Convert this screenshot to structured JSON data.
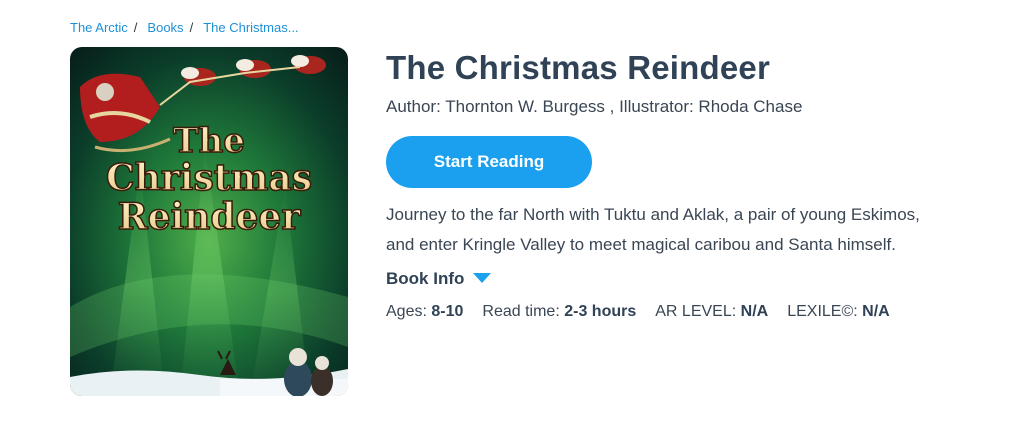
{
  "breadcrumb": {
    "items": [
      "The Arctic",
      "Books",
      "The Christmas..."
    ],
    "separator": "/"
  },
  "cover": {
    "title_lines": [
      "The",
      "Christmas",
      "Reindeer"
    ],
    "icon": "book-cover-image"
  },
  "book": {
    "title": "The Christmas Reindeer",
    "author_line": "Author: Thornton W. Burgess , Illustrator: Rhoda Chase",
    "start_label": "Start Reading",
    "description": "Journey to the far North with Tuktu and Aklak, a pair of young Eskimos, and enter Kringle Valley to meet magical caribou and Santa himself.",
    "book_info_label": "Book Info",
    "book_info_icon": "caret-down-icon"
  },
  "meta": {
    "ages_label": "Ages:",
    "ages_value": "8-10",
    "read_label": "Read time:",
    "read_value": "2-3 hours",
    "ar_label": "AR LEVEL:",
    "ar_value": "N/A",
    "lexile_label": "LEXILE©:",
    "lexile_value": "N/A"
  },
  "colors": {
    "accent": "#1aa0ee",
    "link": "#1e90d8",
    "heading": "#2f4256"
  }
}
